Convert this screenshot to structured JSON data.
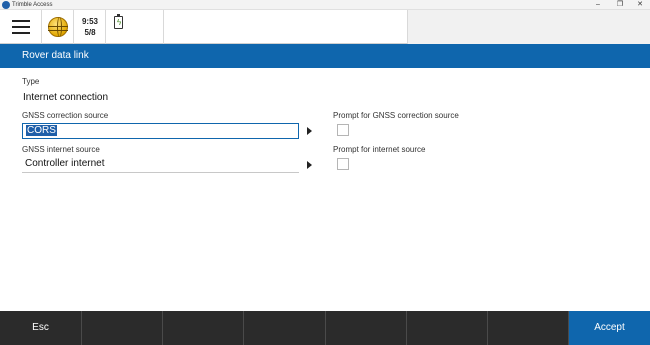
{
  "window": {
    "title": "Trimble Access",
    "minimize": "–",
    "maximize": "❐",
    "close": "✕"
  },
  "status": {
    "time": "9:53",
    "satellites": "5/8"
  },
  "header": {
    "title": "Rover data link"
  },
  "form": {
    "type_label": "Type",
    "type_value": "Internet connection",
    "gnss_correction_label": "GNSS correction source",
    "gnss_correction_value": "CORS",
    "gnss_internet_label": "GNSS internet source",
    "gnss_internet_value": "Controller internet",
    "prompt_correction_label": "Prompt for GNSS correction source",
    "prompt_correction_checked": false,
    "prompt_internet_label": "Prompt for internet source",
    "prompt_internet_checked": false
  },
  "softkeys": {
    "esc": "Esc",
    "accept": "Accept"
  },
  "colors": {
    "accent": "#0f66ad",
    "bottom_bar": "#2b2b2b"
  },
  "icons": [
    "hamburger-menu-icon",
    "globe-icon",
    "battery-charging-icon",
    "right-arrow-icon"
  ]
}
